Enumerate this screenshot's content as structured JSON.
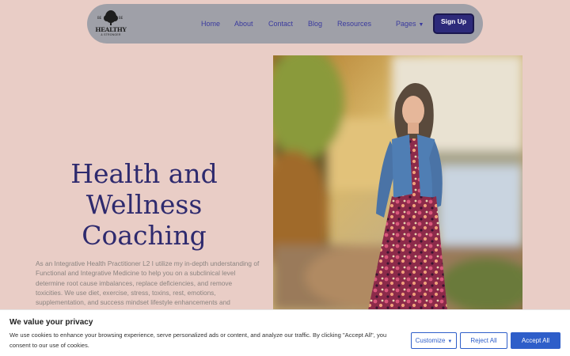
{
  "header": {
    "logo": {
      "top_text": "BE & BE",
      "title": "HEALTHY",
      "subtitle": "& STRONGER"
    },
    "nav_links": [
      {
        "label": "Home"
      },
      {
        "label": "About"
      },
      {
        "label": "Contact"
      },
      {
        "label": "Blog"
      },
      {
        "label": "Resources"
      }
    ],
    "pages_label": "Pages",
    "signup_label": "Sign Up"
  },
  "hero": {
    "title_lines": [
      "Health and",
      "Wellness",
      "Coaching"
    ],
    "body": "As an Integrative Health Practitioner L2 I utilize my in-depth understanding of Functional and Integrative Medicine to help you on a subclinical level determine root cause imbalances, replace deficiencies, and remove toxicities. We use diet, exercise, stress, toxins, rest, emotions, supplementation, and success mindset lifestyle enhancements and modifications to help you improve your health and wellness."
  },
  "photo": {
    "alt": "Woman in denim jacket and floral dress smiling outdoors by a river in autumn"
  },
  "cookie_banner": {
    "title": "We value your privacy",
    "text": "We use cookies to enhance your browsing experience, serve personalized ads or content, and analyze our traffic. By clicking \"Accept All\", you consent to our use of cookies.",
    "customize_label": "Customize",
    "reject_label": "Reject All",
    "accept_label": "Accept All"
  },
  "colors": {
    "page_bg": "#e9cdc6",
    "nav_bg": "#9fa0a8",
    "nav_link": "#3a3a9e",
    "signup_bg": "#2d2a7a",
    "title": "#2e2a6e",
    "cookie_accent": "#2e5ec9"
  },
  "icons": {
    "pages_caret": "caret-down-icon",
    "customize_caret": "caret-down-icon",
    "logo": "tree-logo"
  }
}
